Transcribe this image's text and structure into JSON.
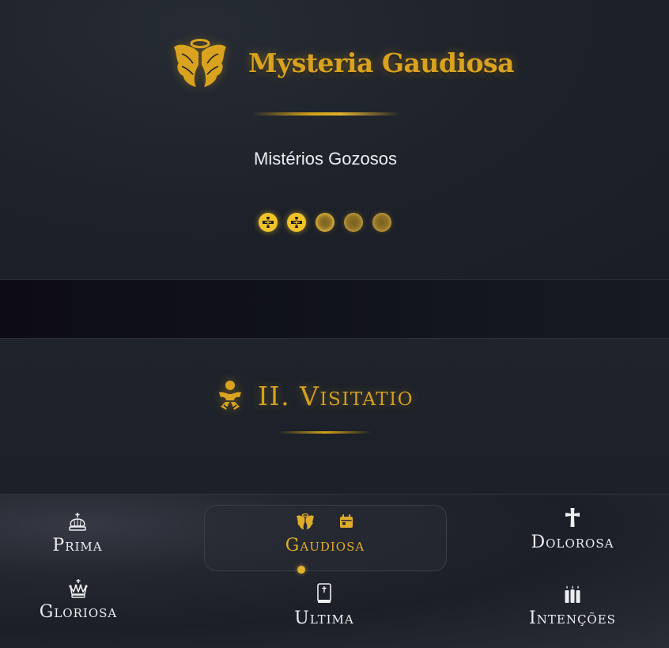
{
  "hero": {
    "title": "Mysteria Gaudiosa",
    "subtitle": "Mistérios Gozosos",
    "progress": {
      "completed": 2,
      "total": 5
    }
  },
  "section": {
    "title": "II. Visitatio"
  },
  "nav": {
    "items": [
      {
        "label": "Prima",
        "icon": "crown-icon"
      },
      {
        "label": "Gaudiosa",
        "icon": "angel-icon",
        "active": true,
        "extra_icon": "calendar-icon"
      },
      {
        "label": "Dolorosa",
        "icon": "cross-icon"
      },
      {
        "label": "Gloriosa",
        "icon": "royal-crown-icon"
      },
      {
        "label": "Ultima",
        "icon": "bible-icon"
      },
      {
        "label": "Intenções",
        "icon": "candles-icon"
      }
    ]
  },
  "colors": {
    "gold": "#d9a21f",
    "bead_done": "#f2c22a",
    "background": "#1c2028",
    "text": "#eceef2"
  }
}
